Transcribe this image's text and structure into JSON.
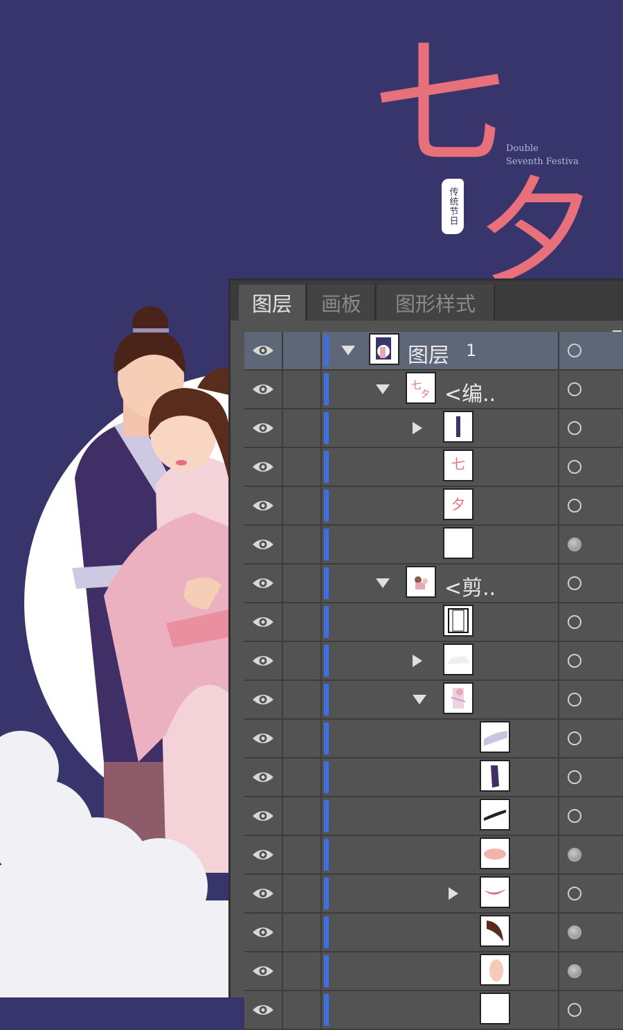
{
  "poster": {
    "title_char_1": "七",
    "title_char_2": "夕",
    "english_line_1": "Double",
    "english_line_2": "Seventh Festiva",
    "seal_text": "传统节日",
    "colors": {
      "background": "#37356b",
      "title": "#e8707a",
      "moon": "#ffffff",
      "cloud": "#f1f0f4"
    }
  },
  "panel": {
    "tabs": [
      {
        "label": "图层",
        "active": true
      },
      {
        "label": "画板",
        "active": false
      },
      {
        "label": "图形样式",
        "active": false
      }
    ],
    "menu_icon": "panel-menu-triangle-icon",
    "layers": [
      {
        "name": "图层",
        "number": "1",
        "depth": 0,
        "toggle": "expanded",
        "thumb": "layer-artwork",
        "selected": true,
        "target": "hollow"
      },
      {
        "name": "<编..",
        "depth": 1,
        "toggle": "expanded",
        "thumb": "qixi-title",
        "selected": false,
        "target": "hollow"
      },
      {
        "name": "",
        "depth": 2,
        "toggle": "collapsed",
        "thumb": "seal-text",
        "selected": false,
        "target": "hollow"
      },
      {
        "name": "",
        "depth": 2,
        "toggle": "none",
        "thumb": "qi-char",
        "selected": false,
        "target": "hollow"
      },
      {
        "name": "",
        "depth": 2,
        "toggle": "none",
        "thumb": "xi-char",
        "selected": false,
        "target": "hollow"
      },
      {
        "name": "",
        "depth": 2,
        "toggle": "none",
        "thumb": "blank",
        "selected": false,
        "target": "filled"
      },
      {
        "name": "<剪..",
        "depth": 1,
        "toggle": "expanded",
        "thumb": "couple",
        "selected": false,
        "target": "hollow"
      },
      {
        "name": "",
        "depth": 2,
        "toggle": "none",
        "thumb": "frame",
        "selected": false,
        "target": "hollow"
      },
      {
        "name": "",
        "depth": 2,
        "toggle": "collapsed",
        "thumb": "cloud",
        "selected": false,
        "target": "hollow"
      },
      {
        "name": "",
        "depth": 2,
        "toggle": "expanded",
        "thumb": "figure",
        "selected": false,
        "target": "hollow"
      },
      {
        "name": "",
        "depth": 3,
        "toggle": "none",
        "thumb": "lavender-stroke",
        "selected": false,
        "target": "hollow"
      },
      {
        "name": "",
        "depth": 3,
        "toggle": "none",
        "thumb": "purple-shape",
        "selected": false,
        "target": "hollow"
      },
      {
        "name": "",
        "depth": 3,
        "toggle": "none",
        "thumb": "eyelash",
        "selected": false,
        "target": "hollow"
      },
      {
        "name": "",
        "depth": 3,
        "toggle": "none",
        "thumb": "cheek",
        "selected": false,
        "target": "filled"
      },
      {
        "name": "",
        "depth": 3,
        "toggle": "collapsed",
        "thumb": "lips",
        "selected": false,
        "target": "hollow"
      },
      {
        "name": "",
        "depth": 3,
        "toggle": "none",
        "thumb": "hair",
        "selected": false,
        "target": "filled"
      },
      {
        "name": "",
        "depth": 3,
        "toggle": "none",
        "thumb": "skin",
        "selected": false,
        "target": "filled"
      },
      {
        "name": "",
        "depth": 3,
        "toggle": "none",
        "thumb": "blank",
        "selected": false,
        "target": "hollow"
      }
    ]
  }
}
